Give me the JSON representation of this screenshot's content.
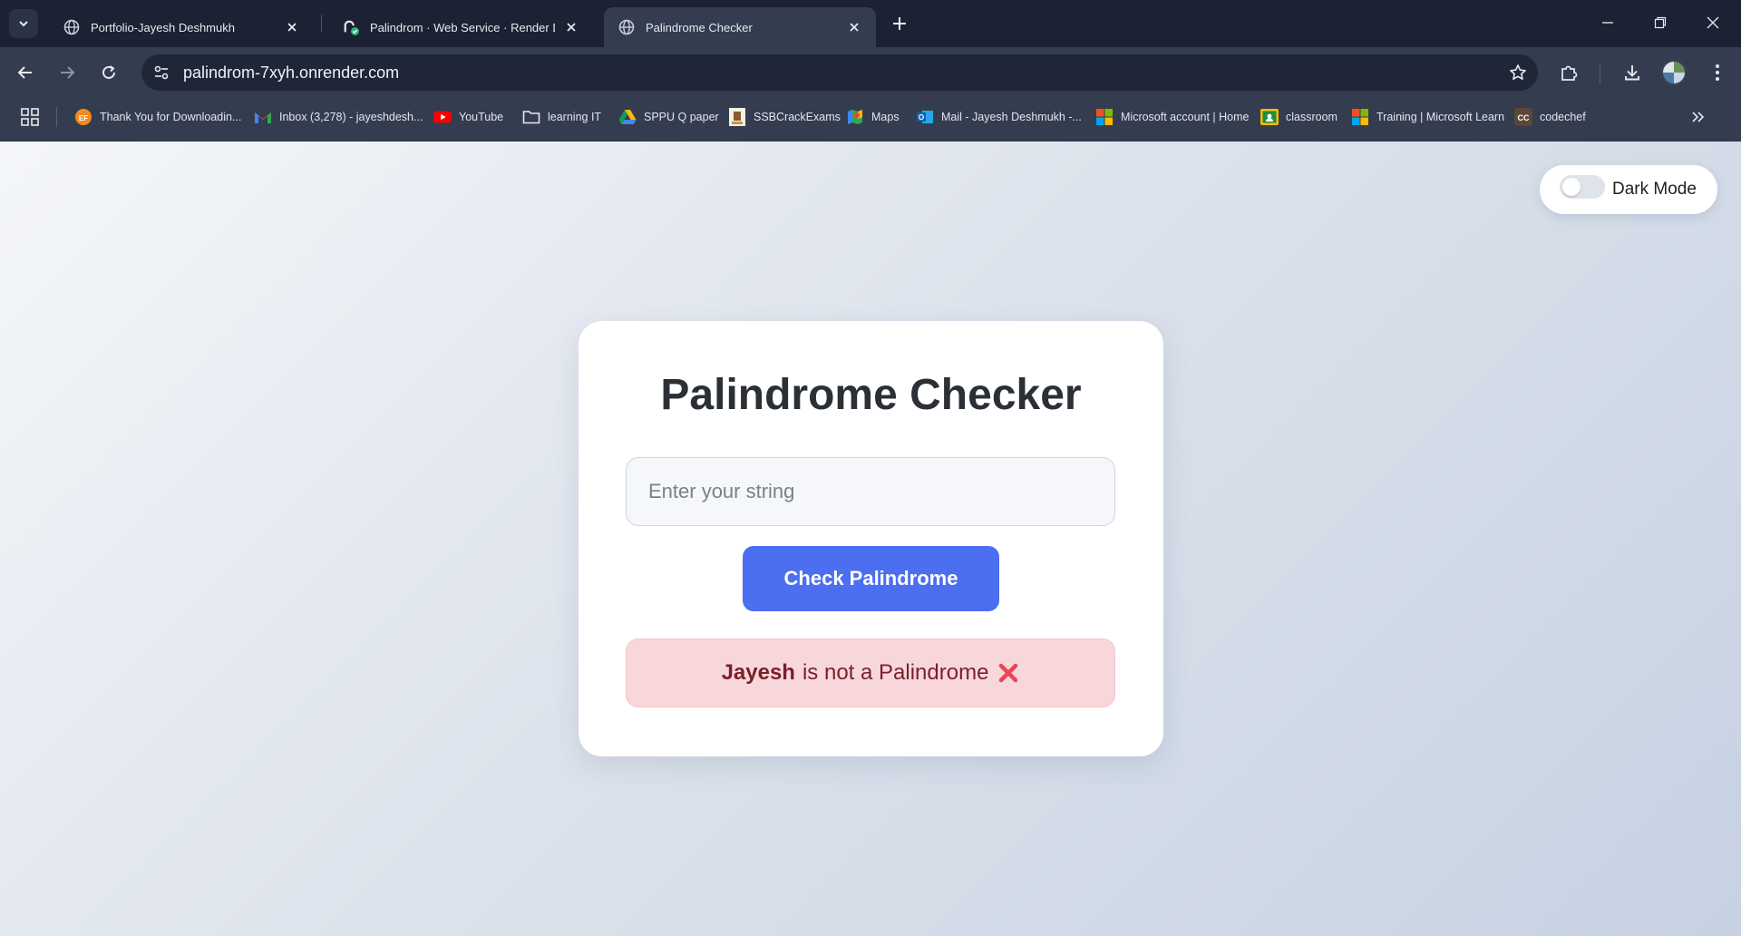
{
  "browser": {
    "tabs": [
      {
        "title": "Portfolio-Jayesh Deshmukh",
        "icon": "globe-icon",
        "active": false
      },
      {
        "title": "Palindrom · Web Service · Render Dashboard",
        "icon": "render-icon",
        "active": false
      },
      {
        "title": "Palindrome Checker",
        "icon": "globe-icon",
        "active": true
      }
    ],
    "url": "palindrom-7xyh.onrender.com",
    "bookmarks": [
      {
        "label": "Thank You for Downloadin...",
        "icon": "ef-icon"
      },
      {
        "label": "Inbox (3,278) - jayeshdesh...",
        "icon": "gmail-icon"
      },
      {
        "label": "YouTube",
        "icon": "youtube-icon"
      },
      {
        "label": "learning IT",
        "icon": "folder-icon"
      },
      {
        "label": "SPPU Q paper",
        "icon": "google-drive-icon"
      },
      {
        "label": "SSBCrackExams",
        "icon": "ssb-icon"
      },
      {
        "label": "Maps",
        "icon": "maps-icon"
      },
      {
        "label": "Mail - Jayesh Deshmukh -...",
        "icon": "outlook-icon"
      },
      {
        "label": "Microsoft account | Home",
        "icon": "microsoft-icon"
      },
      {
        "label": "classroom",
        "icon": "classroom-icon"
      },
      {
        "label": "Training | Microsoft Learn",
        "icon": "microsoft-icon"
      },
      {
        "label": "codechef",
        "icon": "codechef-icon"
      }
    ]
  },
  "page": {
    "dark_mode_label": "Dark Mode",
    "dark_mode_on": false,
    "title": "Palindrome Checker",
    "input_placeholder": "Enter your string",
    "input_value": "",
    "button_label": "Check Palindrome",
    "result": {
      "word": "Jayesh",
      "message": "is not a Palindrome",
      "icon": "cross-mark-icon"
    }
  },
  "colors": {
    "accent": "#4c6ef0",
    "result_bg": "#f8d7da",
    "result_text": "#7a1f2a",
    "error_icon": "#e8455a"
  }
}
